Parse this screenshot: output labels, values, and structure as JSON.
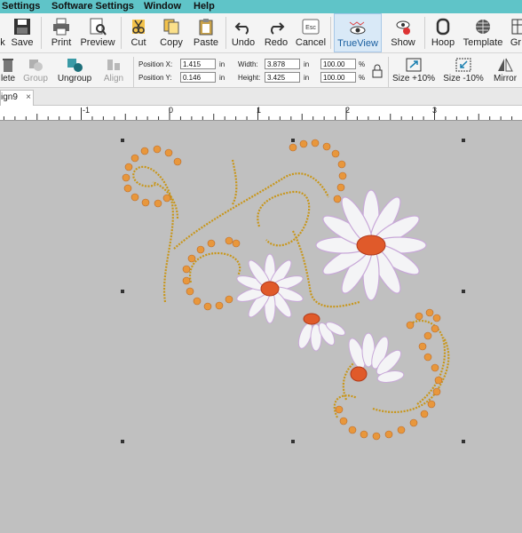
{
  "menu": [
    "Settings",
    "Software Settings",
    "Window",
    "Help"
  ],
  "toolbar": {
    "save": "Save",
    "print": "Print",
    "preview": "Preview",
    "cut": "Cut",
    "copy": "Copy",
    "paste": "Paste",
    "undo": "Undo",
    "redo": "Redo",
    "cancel": "Cancel",
    "cancel_key": "Esc",
    "trueview": "TrueView",
    "show": "Show",
    "hoop": "Hoop",
    "template": "Template",
    "cut_off": "Gr"
  },
  "toolbar2": {
    "delete": "lete",
    "group": "Group",
    "ungroup": "Ungroup",
    "align": "Align",
    "position_x_label": "Position X:",
    "position_y_label": "Position Y:",
    "position_x": "1.415",
    "position_y": "0.146",
    "width_label": "Width:",
    "height_label": "Height:",
    "width": "3.878",
    "height": "3.425",
    "unit": "in",
    "scale_w": "100.00",
    "scale_h": "100.00",
    "percent": "%",
    "size_plus": "Size +10%",
    "size_minus": "Size -10%",
    "mirror": "Mirror"
  },
  "tab": {
    "label": "ign9",
    "close": "×"
  },
  "ruler": [
    "-1",
    "0",
    "1",
    "2",
    "3"
  ],
  "colors": {
    "menubar": "#5fc4c8",
    "canvas": "#c0c0c0",
    "gold": "#d4a62a",
    "orange": "#e8923a",
    "petal": "#f4f4f6",
    "center": "#e05a2a"
  }
}
